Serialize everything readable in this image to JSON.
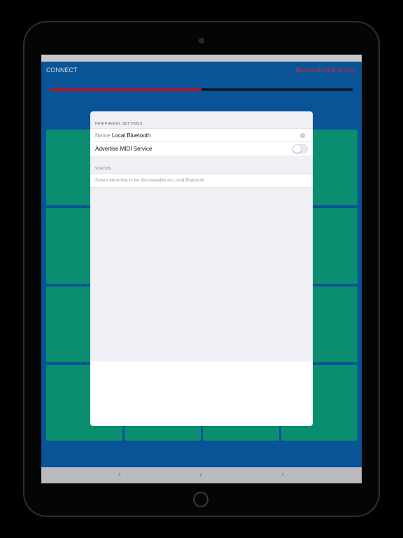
{
  "header": {
    "connect_label": "CONNECT",
    "app_title": "Bluetooth Midi Motion"
  },
  "progress": {
    "value": 0.5,
    "fill_color": "#c0182e",
    "track_color": "#0b1f3d"
  },
  "pads": {
    "count": 16,
    "color": "#0c9b7a"
  },
  "axes": {
    "x": "x",
    "y": "y",
    "z": "z"
  },
  "modal": {
    "peripheral_header": "PERIPHERAL SETTINGS",
    "name_label": "Name",
    "name_value": "Local Bluetooth",
    "advertise_label": "Advertise MIDI Service",
    "advertise_on": false,
    "status_header": "STATUS",
    "status_text": "Select Advertise to be discoverable as Local Bluetooth"
  },
  "colors": {
    "background": "#0a5ca3",
    "accent": "#d6304a"
  }
}
